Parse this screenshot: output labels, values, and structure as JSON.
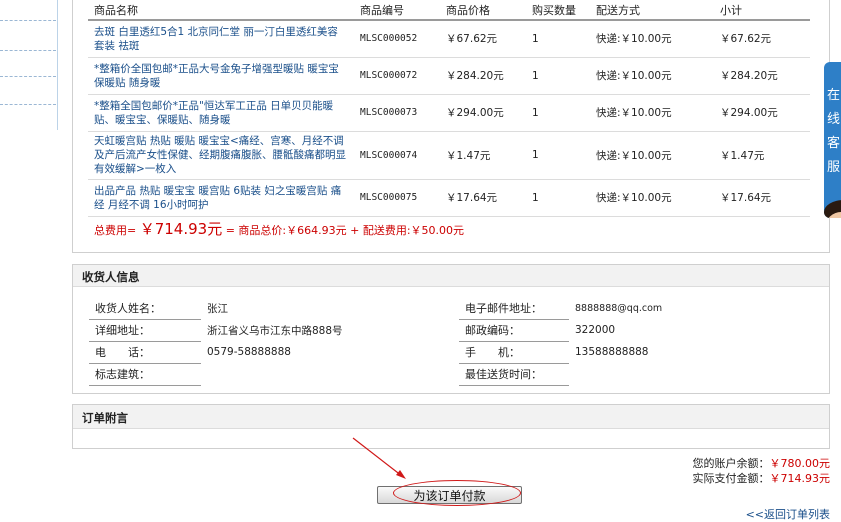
{
  "products": {
    "headers": [
      "商品名称",
      "商品编号",
      "商品价格",
      "购买数量",
      "配送方式",
      "小计"
    ],
    "rows": [
      {
        "name": "去斑 白里透红5合1 北京同仁堂 丽一汀白里透红美容套装 祛斑",
        "code": "MLSC000052",
        "price": "￥67.62元",
        "qty": "1",
        "shipping": "快递:￥10.00元",
        "subtotal": "￥67.62元"
      },
      {
        "name": "*整箱价全国包邮*正品大号金兔子增强型暖贴 暖宝宝 保暖贴 随身暖",
        "code": "MLSC000072",
        "price": "￥284.20元",
        "qty": "1",
        "shipping": "快递:￥10.00元",
        "subtotal": "￥284.20元"
      },
      {
        "name": "*整箱全国包邮价*正品\"恒达军工正品 日单贝贝能暖贴、暖宝宝、保暖贴、随身暖",
        "code": "MLSC000073",
        "price": "￥294.00元",
        "qty": "1",
        "shipping": "快递:￥10.00元",
        "subtotal": "￥294.00元"
      },
      {
        "name": "天虹暖宫贴 热贴 暖贴 暖宝宝<痛经、宫寒、月经不调及产后流产女性保健、经期腹痛腹胀、腰骶酸痛都明显有效缓解>一枚入",
        "code": "MLSC000074",
        "price": "￥1.47元",
        "qty": "1",
        "shipping": "快递:￥10.00元",
        "subtotal": "￥1.47元"
      },
      {
        "name": "出品产品 热贴 暖宝宝 暖宫贴 6贴装 妇之宝暖宫贴 痛经 月经不调 16小时呵护",
        "code": "MLSC000075",
        "price": "￥17.64元",
        "qty": "1",
        "shipping": "快递:￥10.00元",
        "subtotal": "￥17.64元"
      }
    ],
    "total_label": "总费用=",
    "total_amount": "￥714.93元",
    "total_breakdown": "= 商品总价:￥664.93元 + 配送费用:￥50.00元"
  },
  "recipient": {
    "title": "收货人信息",
    "name_label": "收货人姓名：",
    "name_value": "张江",
    "email_label": "电子邮件地址：",
    "email_value": "8888888@qq.com",
    "address_label": "详细地址：",
    "address_value": "浙江省义乌市江东中路888号",
    "zip_label": "邮政编码：",
    "zip_value": "322000",
    "phone_label": "电　　话：",
    "phone_value": "0579-58888888",
    "mobile_label": "手　　机：",
    "mobile_value": "13588888888",
    "landmark_label": "标志建筑：",
    "landmark_value": "",
    "time_label": "最佳送货时间：",
    "time_value": ""
  },
  "memo": {
    "title": "订单附言"
  },
  "balance": {
    "account_label": "您的账户余额：",
    "account_value": "￥780.00元",
    "pay_label": "实际支付金额：",
    "pay_value": "￥714.93元"
  },
  "actions": {
    "pay_button": "为该订单付款",
    "back_link": "<<返回订单列表"
  },
  "ad": {
    "text": "在线客服"
  }
}
